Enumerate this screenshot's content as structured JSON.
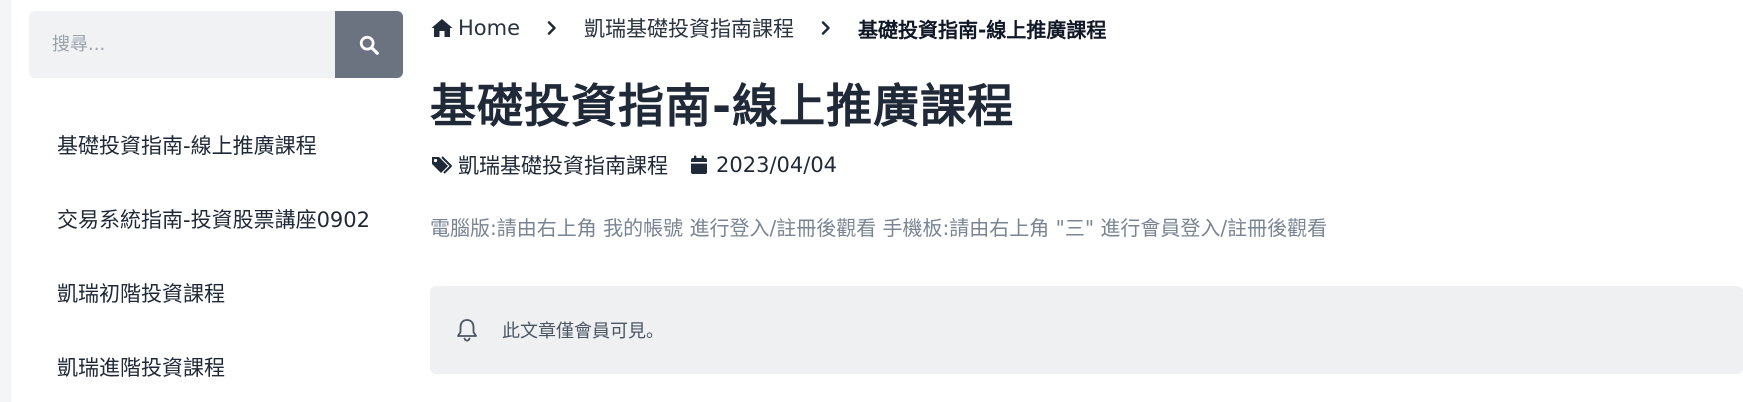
{
  "search": {
    "placeholder": "搜尋...",
    "button_icon": "search-icon"
  },
  "sidebar": {
    "items": [
      {
        "label": "基礎投資指南-線上推廣課程"
      },
      {
        "label": "交易系統指南-投資股票講座0902"
      },
      {
        "label": "凱瑞初階投資課程"
      },
      {
        "label": "凱瑞進階投資課程"
      }
    ]
  },
  "breadcrumb": {
    "home": "Home",
    "category": "凱瑞基礎投資指南課程",
    "current": "基礎投資指南-線上推廣課程"
  },
  "article": {
    "title": "基礎投資指南-線上推廣課程",
    "tag": "凱瑞基礎投資指南課程",
    "date": "2023/04/04",
    "notice": "電腦版:請由右上角 我的帳號 進行登入/註冊後觀看 手機板:請由右上角 \"三\" 進行會員登入/註冊後觀看",
    "members_only": "此文章僅會員可見。"
  },
  "colors": {
    "search_button": "#6b7280",
    "search_bg": "#f1f2f4",
    "alert_bg": "#eef0f2",
    "title": "#1f2937",
    "muted": "#7a8593"
  }
}
